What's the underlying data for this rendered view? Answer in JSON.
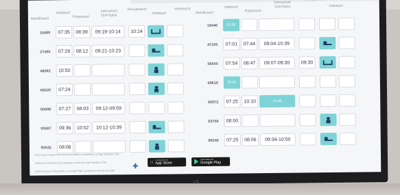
{
  "headers": {
    "identificacio": "Identificació",
    "habitacio": "Habitació",
    "preparacio": "Preparació",
    "intervencio": "Intervenció Quirúrgica",
    "recuperacio": "Recuperació",
    "informacio": "Informació"
  },
  "left_rows": [
    {
      "id": "18489",
      "hab": "07:35",
      "prep": "08:39",
      "int": "09:19-10:14",
      "rec": "10:14",
      "icon": "bed-icon"
    },
    {
      "id": "27495",
      "hab": "07:29",
      "prep": "08:12",
      "int": "09:21-10:23",
      "rec": "",
      "icon": "lying-patient-icon"
    },
    {
      "id": "48062",
      "hab": "10:50",
      "prep": "",
      "int": "",
      "rec": "",
      "icon": "person-icon"
    },
    {
      "id": "68520",
      "hab": "07:24",
      "prep": "",
      "int": "",
      "rec": "",
      "icon": "person-icon"
    },
    {
      "id": "80998",
      "hab": "07:27",
      "prep": "08:03",
      "int": "09:12-09:59",
      "rec": "",
      "icon": ""
    },
    {
      "id": "93587",
      "hab": "09:36",
      "prep": "10:02",
      "int": "10:12-10:39",
      "rec": "",
      "icon": "lying-patient-icon"
    },
    {
      "id": "95532",
      "hab": "08:06",
      "prep": "",
      "int": "",
      "rec": "",
      "icon": "person-icon"
    }
  ],
  "right_rows": [
    {
      "id": "19446",
      "hab": "07:50",
      "prep": "",
      "int": "",
      "rec": "",
      "icon": ""
    },
    {
      "id": "47105",
      "hab": "07:01",
      "prep": "07:44",
      "int": "09:04-10:39",
      "rec": "",
      "icon": "lying-patient-icon"
    },
    {
      "id": "58545",
      "hab": "07:54",
      "prep": "08:47",
      "int": "09:07-09:30",
      "rec": "09:30",
      "icon": "bed-icon"
    },
    {
      "id": "69619",
      "hab": "07:55",
      "prep": "",
      "int": "",
      "rec": "",
      "icon": ""
    },
    {
      "id": "92672",
      "hab": "07:25",
      "prep": "10:10",
      "int": "11:05",
      "rec": "",
      "icon": "surgery-icon"
    },
    {
      "id": "93758",
      "hab": "08:00",
      "prep": "",
      "int": "",
      "rec": "",
      "icon": "person-icon"
    },
    {
      "id": "96240",
      "hab": "07:25",
      "prep": "08:06",
      "int": "09:34-10:50",
      "rec": "",
      "icon": "lying-patient-icon"
    }
  ],
  "footer": {
    "line1": "Pots veure el seguiment de la teva família a la pantalla o a l'app Familiars CSA",
    "line2": "Rebràs la informació de la pantalla a través de l'app Familiars CSA",
    "line3": "Descarrega-la a l'App Store o a Google Play i consulta-la des del teu mòbil",
    "appstore_small": "Consíguela en el",
    "appstore": "App Store",
    "googleplay_small": "DISPONIBLE EN",
    "googleplay": "Google Play"
  },
  "colors": {
    "teal": "#7fd3d6",
    "navy": "#1e3f66"
  }
}
